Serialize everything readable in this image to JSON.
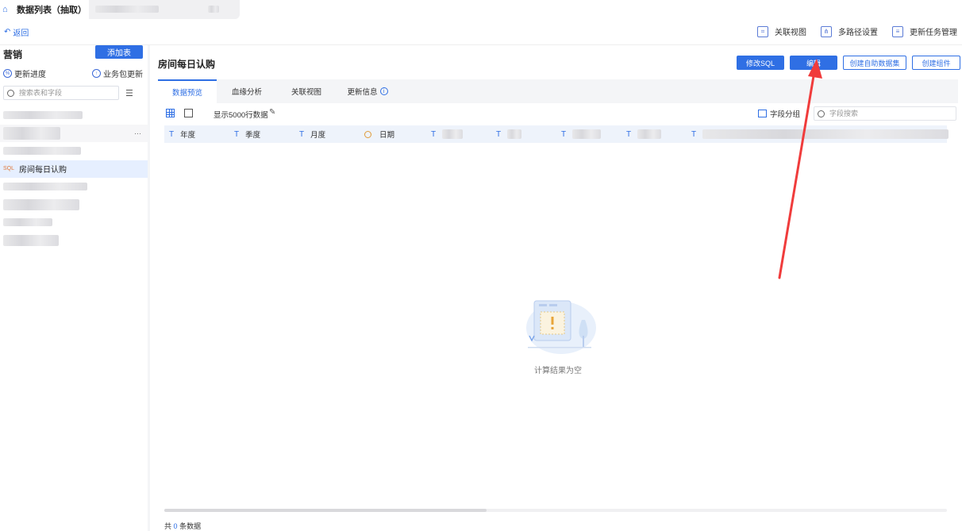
{
  "top": {
    "title": "数据列表（抽取）"
  },
  "subbar": {
    "back": "返回",
    "tools": [
      {
        "label": "关联视图",
        "icon": "relation-view-icon"
      },
      {
        "label": "多路径设置",
        "icon": "multi-path-icon"
      },
      {
        "label": "更新任务管理",
        "icon": "task-manage-icon"
      }
    ]
  },
  "sidebar": {
    "heading": "营销",
    "add_button": "添加表",
    "progress": "更新进度",
    "package_update": "业务包更新",
    "search_placeholder": "搜索表和字段",
    "active_item": {
      "tag": "SQL",
      "label": "房间每日认购"
    },
    "more": "···"
  },
  "main": {
    "title": "房间每日认购",
    "buttons": {
      "edit_sql": "修改SQL",
      "edit": "编辑",
      "create_dataset": "创建自助数据集",
      "create_component": "创建组件"
    },
    "tabs": [
      {
        "label": "数据预览",
        "active": true
      },
      {
        "label": "血缘分析",
        "active": false
      },
      {
        "label": "关联视图",
        "active": false
      },
      {
        "label": "更新信息",
        "active": false
      }
    ],
    "rows_text": "显示5000行数据",
    "group_label": "字段分组",
    "field_search_placeholder": "字段搜索",
    "columns": [
      {
        "type": "T",
        "label": "年度"
      },
      {
        "type": "T",
        "label": "季度"
      },
      {
        "type": "T",
        "label": "月度"
      },
      {
        "type": "date",
        "label": "日期"
      }
    ],
    "empty_text": "计算结果为空",
    "footer": {
      "prefix": "共",
      "count": "0",
      "suffix": "条数据"
    }
  },
  "colors": {
    "accent": "#2f6fe4",
    "annotation": "#f03c3c"
  }
}
